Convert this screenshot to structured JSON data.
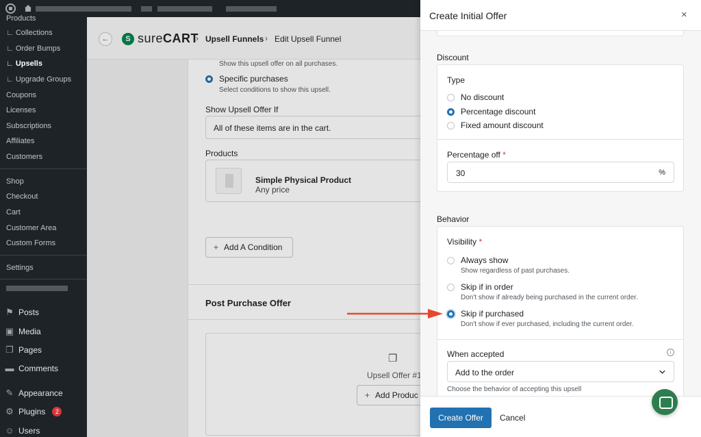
{
  "sidebar": {
    "submenu": [
      {
        "label": "Products"
      },
      {
        "label": "∟ Collections"
      },
      {
        "label": "∟ Order Bumps"
      },
      {
        "label": "∟ Upsells"
      },
      {
        "label": "∟ Upgrade Groups"
      },
      {
        "label": "Coupons"
      },
      {
        "label": "Licenses"
      },
      {
        "label": "Subscriptions"
      },
      {
        "label": "Affiliates"
      },
      {
        "label": "Customers"
      },
      {
        "label": "Shop"
      },
      {
        "label": "Checkout"
      },
      {
        "label": "Cart"
      },
      {
        "label": "Customer Area"
      },
      {
        "label": "Custom Forms"
      },
      {
        "label": "Settings"
      }
    ],
    "main": [
      {
        "label": "Posts",
        "icon": "pin-icon"
      },
      {
        "label": "Media",
        "icon": "media-icon"
      },
      {
        "label": "Pages",
        "icon": "pages-icon"
      },
      {
        "label": "Comments",
        "icon": "comments-icon"
      },
      {
        "label": "Appearance",
        "icon": "brush-icon"
      },
      {
        "label": "Plugins",
        "icon": "plugins-icon",
        "badge": "2"
      },
      {
        "label": "Users",
        "icon": "users-icon"
      }
    ]
  },
  "header": {
    "brand_sure": "sure",
    "brand_cart": "CART",
    "crumb_1": "Upsell Funnels",
    "crumb_2": "Edit Upsell Funnel",
    "sep": "›"
  },
  "conditions": {
    "all_purchases_desc": "Show this upsell offer on all purchases.",
    "specific_label": "Specific purchases",
    "specific_desc": "Select conditions to show this upsell.",
    "show_if_label": "Show Upsell Offer If",
    "show_if_value": "All of these items are in the cart.",
    "products_label": "Products",
    "product_name": "Simple Physical Product",
    "product_price": "Any price",
    "add_condition": "Add A Condition"
  },
  "post_purchase": {
    "title": "Post Purchase Offer",
    "offer_label": "Upsell Offer #1",
    "add_product": "Add Produc"
  },
  "drawer": {
    "title": "Create Initial Offer",
    "close": "×",
    "discount": {
      "section": "Discount",
      "type_label": "Type",
      "options": [
        "No discount",
        "Percentage discount",
        "Fixed amount discount"
      ],
      "selected": 1,
      "percent_label": "Percentage off",
      "percent_value": "30",
      "percent_suffix": "%"
    },
    "behavior": {
      "section": "Behavior",
      "visibility_label": "Visibility",
      "options": [
        {
          "label": "Always show",
          "desc": "Show regardless of past purchases."
        },
        {
          "label": "Skip if in order",
          "desc": "Don't show if already being purchased in the current order."
        },
        {
          "label": "Skip if purchased",
          "desc": "Don't show if ever purchased, including the current order."
        }
      ],
      "selected": 2,
      "accepted_label": "When accepted",
      "accepted_value": "Add to the order",
      "accepted_help": "Choose the behavior of accepting this upsell"
    },
    "required_mark": "*",
    "create_btn": "Create Offer",
    "cancel_btn": "Cancel"
  },
  "colors": {
    "accent": "#2271b1",
    "arrow": "#e8472a",
    "chat": "#2e7d4f",
    "admin_dark": "#1d2327"
  }
}
